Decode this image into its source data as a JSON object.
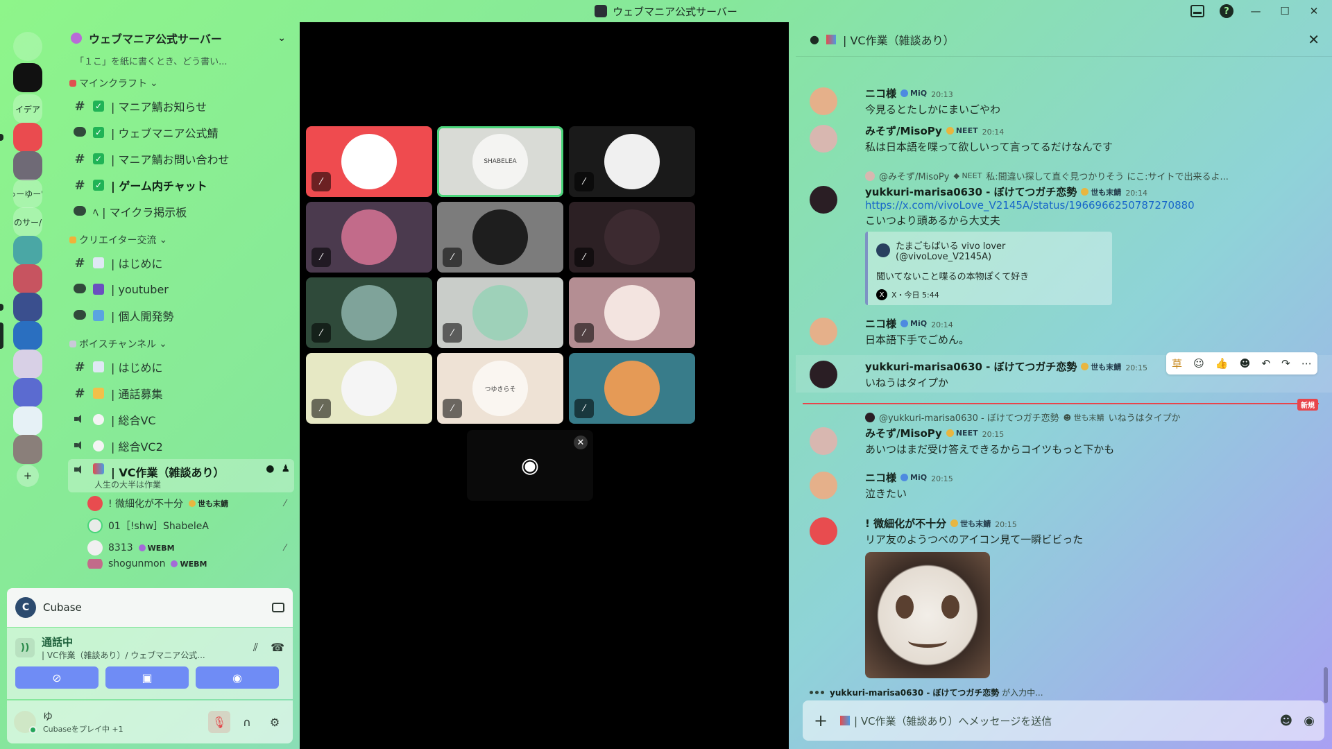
{
  "window": {
    "title": "ウェブマニア公式サーバー",
    "controls": [
      "—",
      "☐",
      "✕"
    ]
  },
  "rail": {
    "items": [
      {
        "kind": "icon",
        "name": "discord-home",
        "color": "#2b2f36",
        "y": 0
      },
      {
        "kind": "icon",
        "name": "quote-server",
        "color": "#111111",
        "y": 1
      },
      {
        "kind": "text",
        "label": "イデア",
        "y": 2
      },
      {
        "kind": "icon",
        "name": "discord-red",
        "color": "#ea4b4f",
        "y": 3
      },
      {
        "kind": "icon",
        "name": "server-a",
        "color": "#6f6a76",
        "y": 4
      },
      {
        "kind": "text",
        "label": "ゅーゆー's",
        "y": 5
      },
      {
        "kind": "text",
        "label": "のサー/",
        "y": 6
      },
      {
        "kind": "icon",
        "name": "server-b",
        "color": "#4aa7a5",
        "y": 7
      },
      {
        "kind": "icon",
        "name": "server-c",
        "color": "#c75460",
        "y": 8
      },
      {
        "kind": "icon",
        "name": "server-d",
        "color": "#3a4f8e",
        "y": 9
      },
      {
        "kind": "icon",
        "name": "server-e",
        "color": "#2a6fc0",
        "y": 10
      },
      {
        "kind": "icon",
        "name": "server-f",
        "color": "#d8d0e6",
        "y": 11
      },
      {
        "kind": "icon",
        "name": "server-g",
        "color": "#5b6bd0",
        "y": 12
      },
      {
        "kind": "icon",
        "name": "server-h",
        "color": "#e6f1f6",
        "y": 13
      },
      {
        "kind": "icon",
        "name": "server-i",
        "color": "#8a7f7a",
        "y": 14
      }
    ],
    "add_label": "+"
  },
  "sidebar": {
    "server_name": "ウェブマニア公式サーバー",
    "partial_line": "「１こ」を紙に書くとき、どう書い...",
    "cat_minecraft": "マインクラフト",
    "cat_creator": "クリエイター交流",
    "cat_voice": "ボイスチャンネル",
    "ch": {
      "c1": "| マニア鯖お知らせ",
      "c2": "| ウェブマニア公式鯖",
      "c3": "| マニア鯖お問い合わせ",
      "c4": "| ゲーム内チャット",
      "c5": "ﾍ | マイクラ掲示板",
      "c6": "| はじめに",
      "c7": "| youtuber",
      "c8": "| 個人開発勢",
      "c9": "| はじめに",
      "c10": "| 通話募集",
      "c11": "| 総合VC",
      "c12": "| 総合VC2",
      "c13": "| VC作業（雑談あり）",
      "c13_sub": "人生の大半は作業"
    },
    "members": {
      "m1": "! 微細化が不十分",
      "m1_tag": "世も末鯖",
      "m2": "01［!shw］ShabeleA",
      "m3": "8313",
      "m3_tag": "WEBM",
      "m4": "shogunmon",
      "m4_tag": "WEBM"
    },
    "activity": {
      "app": "Cubase"
    },
    "voice": {
      "status": "通話中",
      "channel": "| VC作業（雑談あり）/ ウェブマニア公式..."
    },
    "user": {
      "name": "ゆ",
      "status": "Cubaseをプレイ中 +1"
    }
  },
  "stage": {
    "tiles": [
      {
        "name": "tile-discord-red",
        "bg": "#ef4b4f",
        "av": "#ffffff",
        "muted": true
      },
      {
        "name": "tile-shabelea",
        "bg": "#d9dbd6",
        "av": "#f4f4f2",
        "muted": false,
        "speaking": true,
        "label": "SHABELEA"
      },
      {
        "name": "tile-catgirl",
        "bg": "#1a1a1a",
        "av": "#f0f0f0",
        "muted": true
      },
      {
        "name": "tile-pink-girl",
        "bg": "#4b3a4e",
        "av": "#c26b8a",
        "muted": true
      },
      {
        "name": "tile-dots",
        "bg": "#7c7c7c",
        "av": "#1e1e1e",
        "muted": true
      },
      {
        "name": "tile-hood",
        "bg": "#2c2024",
        "av": "#3c2a30",
        "muted": true
      },
      {
        "name": "tile-green",
        "bg": "#2f4a3a",
        "av": "#7fa39a",
        "muted": true
      },
      {
        "name": "tile-green-hair",
        "bg": "#c9cdc9",
        "av": "#9ed1b9",
        "muted": true
      },
      {
        "name": "tile-cat-ears",
        "bg": "#b48e93",
        "av": "#f3e4e0",
        "muted": true
      },
      {
        "name": "tile-smile",
        "bg": "#e6e8c4",
        "av": "#f5f5f5",
        "muted": true
      },
      {
        "name": "tile-drawing",
        "bg": "#eee2d5",
        "av": "#faf6f1",
        "muted": true,
        "label": "つゆきらそ"
      },
      {
        "name": "tile-orange-hair",
        "bg": "#387c8a",
        "av": "#e59a56",
        "muted": true
      }
    ]
  },
  "chat": {
    "title": "| VC作業（雑談あり）",
    "messages": {
      "a_name": "ニコ様",
      "a_badge": "MiQ",
      "a_time": "20:13",
      "a_text": "今見るとたしかにまいごやわ",
      "b_name": "みそず/MisoPy",
      "b_badge": "NEET",
      "b_time": "20:14",
      "b_text": "私は日本語を喋って欲しいって言ってるだけなんです",
      "c_reply_to": "@みそず/MisoPy",
      "c_reply_badge": "NEET",
      "c_reply_text": "私:間違い探して直ぐ見つかりそう にこ:サイトで出来るよ...",
      "c_name": "yukkuri-marisa0630 - ぼけてつガチ恋勢",
      "c_badge": "世も末鯖",
      "c_time": "20:14",
      "c_link": "https://x.com/vivoLove_V2145A/status/1966966250787270880",
      "c_text": "こいつより頭あるから大丈夫",
      "embed_author": "たまごもばいる vivo lover (@vivoLove_V2145A)",
      "embed_text": "聞いてないこと喋るの本物ぽくて好き",
      "embed_footer": "X・今日 5:44",
      "d_name": "ニコ様",
      "d_badge": "MiQ",
      "d_time": "20:14",
      "d_text": "日本語下手でごめん。",
      "e_name": "yukkuri-marisa0630 - ぼけてつガチ恋勢",
      "e_badge": "世も末鯖",
      "e_time": "20:15",
      "e_text": "いねうはタイプか",
      "new_label": "新規",
      "f_reply_to": "@yukkuri-marisa0630 - ぼけてつガチ恋勢",
      "f_reply_badge": "世も末鯖",
      "f_reply_text": "いねうはタイプか",
      "f_name": "みそず/MisoPy",
      "f_badge": "NEET",
      "f_time": "20:15",
      "f_text": "あいつはまだ受け答えできるからコイツもっと下かも",
      "g_name": "ニコ様",
      "g_badge": "MiQ",
      "g_time": "20:15",
      "g_text": "泣きたい",
      "h_name": "! 微細化が不十分",
      "h_badge": "世も末鯖",
      "h_time": "20:15",
      "h_text": "リア友のようつべのアイコン見て一瞬ビビった"
    },
    "typing_user": "yukkuri-marisa0630 - ぼけてつガチ恋勢",
    "typing_suffix": "が入力中...",
    "composer_placeholder": "| VC作業（雑談あり）へメッセージを送信"
  },
  "colors": {
    "accent_blue": "#6f8cf5",
    "danger": "#e8454b",
    "online": "#23a55a"
  }
}
